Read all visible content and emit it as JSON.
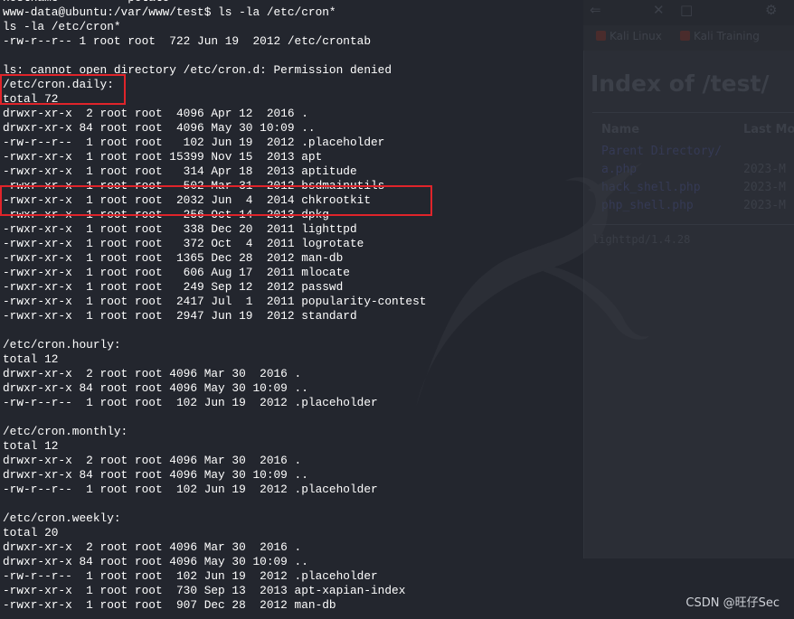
{
  "terminal": {
    "lines": [
      "hostname          potato",
      "www-data@ubuntu:/var/www/test$ ls -la /etc/cron*",
      "ls -la /etc/cron*",
      "-rw-r--r-- 1 root root  722 Jun 19  2012 /etc/crontab",
      "",
      "ls: cannot open directory /etc/cron.d: Permission denied",
      "/etc/cron.daily:",
      "total 72",
      "drwxr-xr-x  2 root root  4096 Apr 12  2016 .",
      "drwxr-xr-x 84 root root  4096 May 30 10:09 ..",
      "-rw-r--r--  1 root root   102 Jun 19  2012 .placeholder",
      "-rwxr-xr-x  1 root root 15399 Nov 15  2013 apt",
      "-rwxr-xr-x  1 root root   314 Apr 18  2013 aptitude",
      "-rwxr-xr-x  1 root root   502 Mar 31  2012 bsdmainutils",
      "-rwxr-xr-x  1 root root  2032 Jun  4  2014 chkrootkit",
      "-rwxr-xr-x  1 root root   256 Oct 14  2013 dpkg",
      "-rwxr-xr-x  1 root root   338 Dec 20  2011 lighttpd",
      "-rwxr-xr-x  1 root root   372 Oct  4  2011 logrotate",
      "-rwxr-xr-x  1 root root  1365 Dec 28  2012 man-db",
      "-rwxr-xr-x  1 root root   606 Aug 17  2011 mlocate",
      "-rwxr-xr-x  1 root root   249 Sep 12  2012 passwd",
      "-rwxr-xr-x  1 root root  2417 Jul  1  2011 popularity-contest",
      "-rwxr-xr-x  1 root root  2947 Jun 19  2012 standard",
      "",
      "/etc/cron.hourly:",
      "total 12",
      "drwxr-xr-x  2 root root 4096 Mar 30  2016 .",
      "drwxr-xr-x 84 root root 4096 May 30 10:09 ..",
      "-rw-r--r--  1 root root  102 Jun 19  2012 .placeholder",
      "",
      "/etc/cron.monthly:",
      "total 12",
      "drwxr-xr-x  2 root root 4096 Mar 30  2016 .",
      "drwxr-xr-x 84 root root 4096 May 30 10:09 ..",
      "-rw-r--r--  1 root root  102 Jun 19  2012 .placeholder",
      "",
      "/etc/cron.weekly:",
      "total 20",
      "drwxr-xr-x  2 root root 4096 Mar 30  2016 .",
      "drwxr-xr-x 84 root root 4096 May 30 10:09 ..",
      "-rw-r--r--  1 root root  102 Jun 19  2012 .placeholder",
      "-rwxr-xr-x  1 root root  730 Sep 13  2013 apt-xapian-index",
      "-rwxr-xr-x  1 root root  907 Dec 28  2012 man-db"
    ]
  },
  "browser_bg": {
    "bookmark_1": "Kali Linux",
    "bookmark_2": "Kali Training",
    "heading": "Index of /test/",
    "col_name": "Name",
    "col_modified": "Last Mo",
    "files": [
      {
        "name": "Parent Directory/",
        "date": ""
      },
      {
        "name": "a.php",
        "date": "2023-M"
      },
      {
        "name": "hack_shell.php",
        "date": "2023-M"
      },
      {
        "name": "php_shell.php",
        "date": "2023-M"
      }
    ],
    "footer": "lighttpd/1.4.28"
  },
  "watermark": "CSDN @旺仔Sec",
  "colors": {
    "terminal_bg": "#23262e",
    "terminal_fg": "#ffffff",
    "highlight": "#e0242a"
  }
}
